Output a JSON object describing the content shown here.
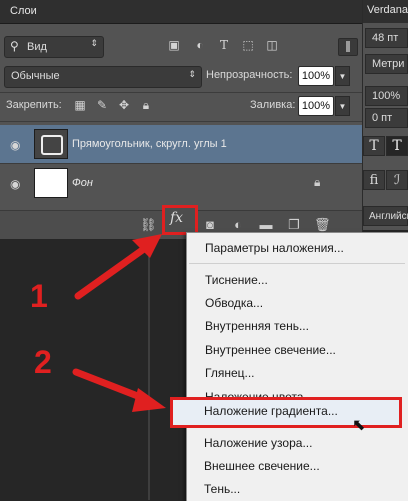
{
  "layers_panel": {
    "tab_title": "Слои",
    "filter": {
      "label": "Вид"
    },
    "blend_mode": "Обычные",
    "opacity_label": "Непрозрачность:",
    "opacity_value": "100%",
    "lock_label": "Закрепить:",
    "fill_label": "Заливка:",
    "fill_value": "100%",
    "layers": [
      {
        "name": "Прямоугольник, скругл. углы 1",
        "selected": true
      },
      {
        "name": "Фон",
        "selected": false
      }
    ],
    "fx_label": "fx"
  },
  "character_panel": {
    "font": "Verdana",
    "size": "48 пт",
    "units": "Метри",
    "scale": "100%",
    "tracking": "0 пт",
    "language": "Английск"
  },
  "context_menu": {
    "items": [
      "Параметры наложения...",
      "Тиснение...",
      "Обводка...",
      "Внутренняя тень...",
      "Внутреннее свечение...",
      "Глянец...",
      "Наложение цвета...",
      "Наложение градиента...",
      "Наложение узора...",
      "Внешнее свечение...",
      "Тень..."
    ],
    "highlighted_index": 7
  },
  "annotations": {
    "step1": "1",
    "step2": "2"
  },
  "colors": {
    "highlight_red": "#e02020",
    "selected_layer": "#5c7590",
    "panel_bg": "#535353"
  }
}
